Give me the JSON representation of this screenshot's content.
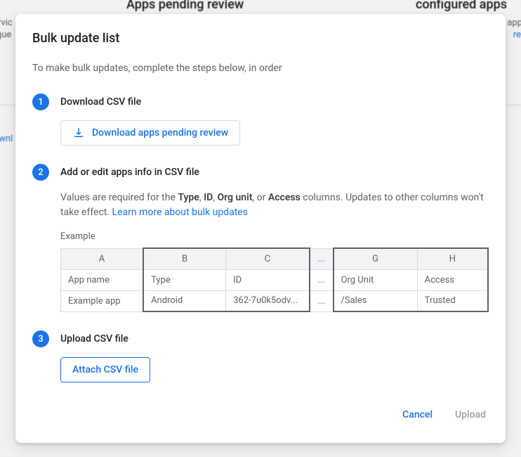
{
  "background": {
    "heading_left": "Apps pending review",
    "heading_right_fragment": "configured apps",
    "service_fragment": "ervic",
    "queue_fragment": "que",
    "apr_fragment": "app",
    "re_fragment": "re",
    "wnl_fragment": "wnl"
  },
  "modal": {
    "title": "Bulk update list",
    "intro": "To make bulk updates, complete the steps below, in order",
    "step1": {
      "num": "1",
      "title": "Download CSV file",
      "button": "Download apps pending review"
    },
    "step2": {
      "num": "2",
      "title": "Add or edit apps info in CSV file",
      "desc_pre": "Values are required for the ",
      "term_type": "Type",
      "sep1": ", ",
      "term_id": "ID",
      "sep2": ", ",
      "term_org": "Org unit",
      "sep3": ", or ",
      "term_access": "Access",
      "desc_post": " columns. Updates to other columns won't take effect. ",
      "learn_more": "Learn more about bulk updates",
      "example_label": "Example",
      "table": {
        "cols": {
          "a": "A",
          "b": "B",
          "c": "C",
          "dots": "...",
          "g": "G",
          "h": "H"
        },
        "row1": {
          "a": "App name",
          "b": "Type",
          "c": "ID",
          "dots": "...",
          "g": "Org Unit",
          "h": "Access"
        },
        "row2": {
          "a": "Example app",
          "b": "Android",
          "c": "362-7u0k5odv...",
          "dots": "...",
          "g": "/Sales",
          "h": "Trusted"
        }
      }
    },
    "step3": {
      "num": "3",
      "title": "Upload CSV file",
      "button": "Attach CSV file"
    },
    "footer": {
      "cancel": "Cancel",
      "upload": "Upload"
    }
  }
}
